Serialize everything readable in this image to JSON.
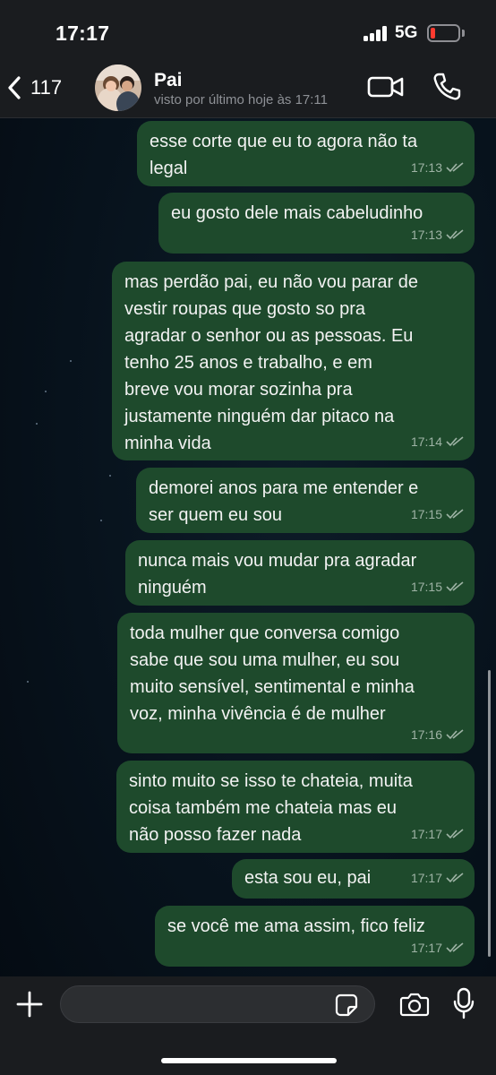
{
  "status_bar": {
    "time": "17:17",
    "network": "5G",
    "battery_level": "low",
    "battery_color": "#ff3b30"
  },
  "header": {
    "back_count": "117",
    "contact_name": "Pai",
    "last_seen": "visto por último hoje às 17:11",
    "icons": [
      "chevron-left-icon",
      "video-camera-icon",
      "phone-icon"
    ]
  },
  "messages": [
    {
      "lines": [
        "esse corte que eu to agora não ta",
        "legal"
      ],
      "time": "17:13",
      "status": "read"
    },
    {
      "lines": [
        "eu gosto dele mais cabeludinho"
      ],
      "time": "17:13",
      "status": "read"
    },
    {
      "lines": [
        "mas perdão pai, eu não vou parar de",
        "vestir roupas que gosto so pra",
        "agradar o senhor ou as pessoas. Eu",
        "tenho 25 anos e trabalho, e em",
        "breve vou morar sozinha pra",
        "justamente ninguém dar pitaco na",
        "minha vida"
      ],
      "time": "17:14",
      "status": "read"
    },
    {
      "lines": [
        "demorei anos para me entender e",
        "ser quem eu sou"
      ],
      "time": "17:15",
      "status": "read"
    },
    {
      "lines": [
        "nunca mais vou mudar pra agradar",
        "ninguém"
      ],
      "time": "17:15",
      "status": "read"
    },
    {
      "lines": [
        "toda mulher que conversa comigo",
        "sabe que sou uma mulher, eu sou",
        "muito sensível, sentimental e minha",
        "voz, minha vivência é de mulher"
      ],
      "time": "17:16",
      "status": "read"
    },
    {
      "lines": [
        "sinto muito se isso te chateia, muita",
        "coisa também me chateia mas eu",
        "não posso fazer nada"
      ],
      "time": "17:17",
      "status": "read"
    },
    {
      "lines": [
        "esta sou eu, pai"
      ],
      "time": "17:17",
      "status": "read"
    },
    {
      "lines": [
        "se você me ama assim, fico feliz"
      ],
      "time": "17:17",
      "status": "read"
    }
  ],
  "input_bar": {
    "placeholder": "",
    "icons": [
      "plus-icon",
      "sticker-icon",
      "camera-icon",
      "microphone-icon"
    ]
  },
  "colors": {
    "outgoing_bubble": "#1e4a2c",
    "bar_background": "#1a1c1f",
    "wallpaper": "#07111b"
  }
}
